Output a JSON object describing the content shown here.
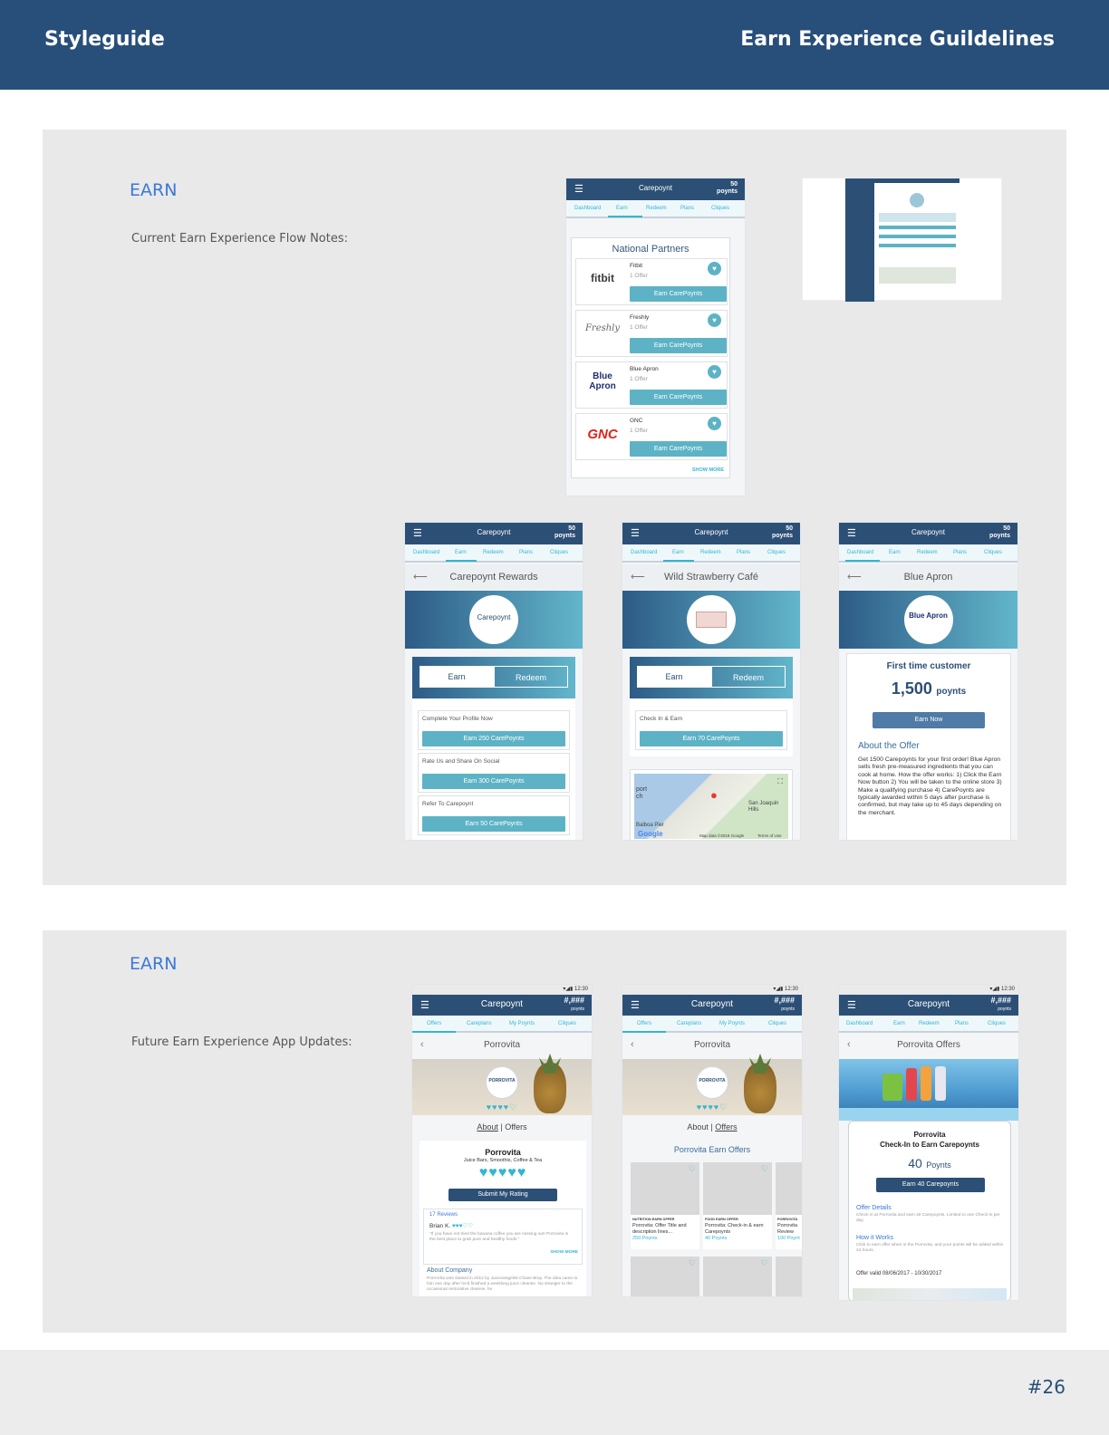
{
  "header": {
    "left_title": "Styleguide",
    "right_title": "Earn Experience Guildelines"
  },
  "section1": {
    "title": "EARN",
    "note": "Current Earn Experience Flow Notes:"
  },
  "section2": {
    "title": "EARN",
    "note": "Future Earn Experience App Updates:"
  },
  "page_number": "#26",
  "app": {
    "logo": "Carepoynt",
    "points_value": "50",
    "points_unit": "poynts",
    "tabs": [
      "Dashboard",
      "Earn",
      "Redeem",
      "Plans",
      "Cliques"
    ]
  },
  "national_partners": {
    "title": "National Partners",
    "partners": [
      {
        "logo": "fitbit",
        "name": "Fitbit",
        "offers": "1 Offer",
        "button": "Earn CarePoynts"
      },
      {
        "logo": "Freshly",
        "name": "Freshly",
        "offers": "1 Offer",
        "button": "Earn CarePoynts"
      },
      {
        "logo": "Blue Apron",
        "name": "Blue Apron",
        "offers": "1 Offer",
        "button": "Earn CarePoynts"
      },
      {
        "logo": "GNC",
        "name": "GNC",
        "offers": "1 Offer",
        "button": "Earn CarePoynts"
      }
    ],
    "show_more": "SHOW MORE"
  },
  "screen_rewards": {
    "title": "Carepoynt Rewards",
    "toggle_earn": "Earn",
    "toggle_redeem": "Redeem",
    "items": [
      {
        "label": "Complete Your Profile Now",
        "button": "Earn 250 CarePoynts"
      },
      {
        "label": "Rate Us and Share On Social",
        "button": "Earn 300 CarePoynts"
      },
      {
        "label": "Refer To Carepoynt",
        "button": "Earn 50 CarePoynts"
      }
    ]
  },
  "screen_cafe": {
    "title": "Wild Strawberry Café",
    "toggle_earn": "Earn",
    "toggle_redeem": "Redeem",
    "item_label": "Check In & Earn",
    "item_button": "Earn 70 CarePoynts",
    "map_labels": [
      "port",
      "ch",
      "San Joaquin Hills",
      "Balboa Pier",
      "Google",
      "Map data ©2018 Google",
      "Terms of Use"
    ]
  },
  "screen_blue_apron": {
    "title": "Blue Apron",
    "logo": "Blue Apron",
    "offer_title": "First time customer",
    "points": "1,500",
    "points_unit": "poynts",
    "button": "Earn Now",
    "about_title": "About the Offer",
    "about_text": "Get 1500 Carepoynts for your first order! Blue Apron sells fresh pre-measured ingredients that you can cook at home. How the offer works: 1) Click the Earn Now button 2) You will be taken to the online store 3) Make a qualifying purchase 4) CarePoynts are typically awarded within 5 days after purchase is confirmed, but may take up to 45 days depending on the merchant."
  },
  "future_app": {
    "status_time": "12:30",
    "app_name": "Carepoynt",
    "points_value": "#,###",
    "points_unit": "poynts",
    "tabs": [
      "Offers",
      "Careplans",
      "My Poynts",
      "Cliques"
    ],
    "tabs_alt": [
      "Dashboard",
      "Earn",
      "Redeem",
      "Plans",
      "Cliques"
    ]
  },
  "screen_porrovita_about": {
    "title": "Porrovita",
    "badge": "PORROVITA",
    "about_link": "About",
    "offers_link": "Offers",
    "name": "Porrovita",
    "category": "Juice Bars, Smoothis, Coffee & Tea",
    "rating_button": "Submit My Rating",
    "reviews_count": "17 Reviews",
    "reviewer": "Brian K.",
    "review_text": "\"If you have not tried the banana coffee you are missing out! Porrovita is the best place to grab pure and healthy foods.\"",
    "show_more": "SHOW MORE",
    "about_company_title": "About Company",
    "about_company_text": "PorroVita was started in 2012 by Juicevangelist Chase Bray. The idea came to him one day after he'd finished a weeklong juice cleanse. No stranger to the occasional restorative cleanse, he"
  },
  "screen_porrovita_offers": {
    "title": "Porrovita",
    "about_link": "About",
    "offers_link": "Offers",
    "section_title": "Porrovita Earn Offers",
    "offers": [
      {
        "tag": "NUTRITION EARN OFFER",
        "title": "Porrovita: Offer Title and description lines...",
        "points": "250 Poynts"
      },
      {
        "tag": "FOOD EARN OFFER",
        "title": "Porrovita: Check-in & earn Carepoynts",
        "points": "40 Poynts"
      },
      {
        "tag": "PORROVITA",
        "title": "Porrovita Review",
        "points": "100 Poynt"
      }
    ]
  },
  "screen_porrovita_detail": {
    "title": "Porrovita Offers",
    "name": "Porrovita",
    "subtitle": "Check-In to Earn Carepoynts",
    "points": "40",
    "points_unit": "Poynts",
    "button": "Earn 40 Carepoynts",
    "offer_details_title": "Offer Details",
    "offer_details_text": "Check in at Porrovita and earn 40 Carepoynts. Limited to one Check-in per day.",
    "how_title": "How it Works",
    "how_text": "Click to earn offer when in the Porrovita, and your points will be added within 24 hours.",
    "valid": "Offer valid 08/06/2017 - 10/30/2017"
  }
}
